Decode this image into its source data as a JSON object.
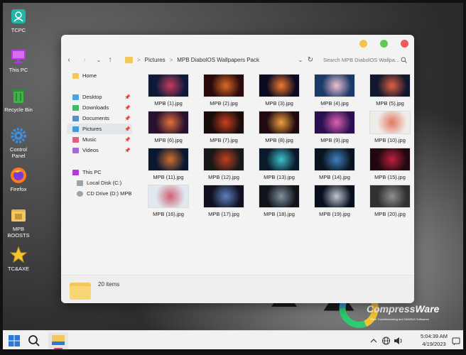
{
  "desktop": {
    "icons": [
      {
        "label": "TCPC",
        "icon": "user-card-icon"
      },
      {
        "label": "This PC",
        "icon": "monitor-icon"
      },
      {
        "label": "Recycle Bin",
        "icon": "recycle-bin-icon"
      },
      {
        "label": "Control Panel",
        "icon": "gear-icon"
      },
      {
        "label": "Firefox",
        "icon": "firefox-icon"
      },
      {
        "label": "MPB BOOSTS",
        "icon": "folder-icon"
      },
      {
        "label": "TC&AXE",
        "icon": "star-icon"
      }
    ]
  },
  "window": {
    "controls": {
      "yellow": "#f5c344",
      "green": "#5ccd4e",
      "red": "#f05a5a"
    },
    "breadcrumb": [
      "Pictures",
      "MPB DiabolOS Wallpapers Pack"
    ],
    "breadcrumb_sep": ">",
    "search_placeholder": "Search MPB DiabolOS Wallpa...",
    "sidebar": {
      "home": "Home",
      "quick": [
        {
          "label": "Desktop",
          "color": "#4aa3df",
          "pinned": true
        },
        {
          "label": "Downloads",
          "color": "#42b86a",
          "pinned": true
        },
        {
          "label": "Documents",
          "color": "#5b8ec9",
          "pinned": true
        },
        {
          "label": "Pictures",
          "color": "#3f9fd6",
          "pinned": true,
          "active": true
        },
        {
          "label": "Music",
          "color": "#e0607e",
          "pinned": true
        },
        {
          "label": "Videos",
          "color": "#a46ad4",
          "pinned": true
        }
      ],
      "pc": "This PC",
      "drives": [
        {
          "label": "Local Disk (C:)"
        },
        {
          "label": "CD Drive (D:) MPB"
        }
      ],
      "pin_glyph": "📌"
    },
    "files": [
      "MPB (1).jpg",
      "MPB (2).jpg",
      "MPB (3).jpg",
      "MPB (4).jpg",
      "MPB (5).jpg",
      "MPB (6).jpg",
      "MPB (7).jpg",
      "MPB (8).jpg",
      "MPB (9).jpg",
      "MPB (10).jpg",
      "MPB (11).jpg",
      "MPB (12).jpg",
      "MPB (13).jpg",
      "MPB (14).jpg",
      "MPB (15).jpg",
      "MPB (16).jpg",
      "MPB (17).jpg",
      "MPB (18).jpg",
      "MPB (19).jpg",
      "MPB (20).jpg"
    ],
    "status": {
      "item_count": "20 items"
    }
  },
  "taskbar": {
    "time": "5:04:39 AM",
    "date": "4/19/2023",
    "accent": "#e0407a"
  },
  "watermark": {
    "text": "CompressWare",
    "sub": "Free Troubleshooting and GAMING Softwares"
  }
}
